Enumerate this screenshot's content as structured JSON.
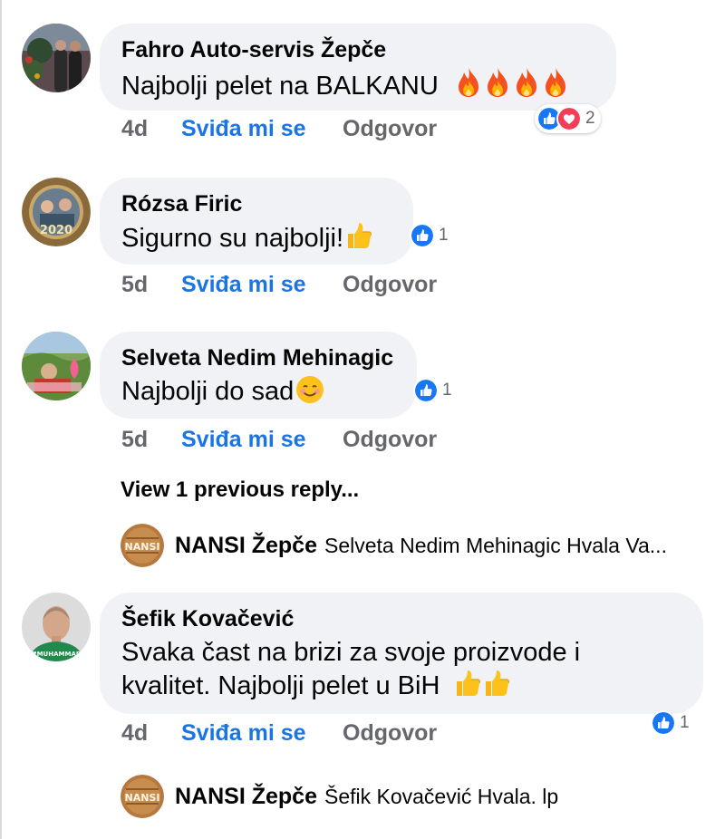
{
  "comments": [
    {
      "author": "Fahro Auto-servis Žepče",
      "text": "Najbolji pelet na BALKANU",
      "emoji_trail": "fire x4",
      "time": "4d",
      "like_label": "Sviđa mi se",
      "reply_label": "Odgovor",
      "reaction_count": "2",
      "reactions": [
        "like-icon",
        "love-icon"
      ]
    },
    {
      "author": "Rózsa Firic",
      "text": "Sigurno su najbolji!",
      "emoji_trail": "thumbs-up",
      "time": "5d",
      "like_label": "Sviđa mi se",
      "reply_label": "Odgovor",
      "reaction_count": "1",
      "reactions": [
        "like-icon"
      ]
    },
    {
      "author": "Selveta Nedim Mehinagic",
      "text": "Najbolji do sad",
      "emoji_trail": "smiling-face",
      "time": "5d",
      "like_label": "Sviđa mi se",
      "reply_label": "Odgovor",
      "reaction_count": "1",
      "reactions": [
        "like-icon"
      ]
    },
    {
      "author": "Šefik Kovačević",
      "text_line1": "Svaka čast na brizi za svoje proizvode i",
      "text_line2": "kvalitet. Najbolji pelet u BiH",
      "emoji_trail": "thumbs-up x2",
      "time": "4d",
      "like_label": "Sviđa mi se",
      "reply_label": "Odgovor",
      "reaction_count": "1",
      "reactions": [
        "like-icon"
      ]
    }
  ],
  "view_previous": "View 1 previous reply...",
  "replies": [
    {
      "author": "NANSI Žepče",
      "text": "Selveta Nedim Mehinagic Hvala Va...",
      "avatar_text": "NANSI"
    },
    {
      "author": "NANSI Žepče",
      "text": "Šefik Kovačević  Hvala. lp",
      "avatar_text": "NANSI"
    }
  ],
  "colors": {
    "bubble": "#f0f2f5",
    "like_blue": "#1b74e4",
    "love_red": "#f33e58",
    "meta_grey": "#65676b"
  }
}
